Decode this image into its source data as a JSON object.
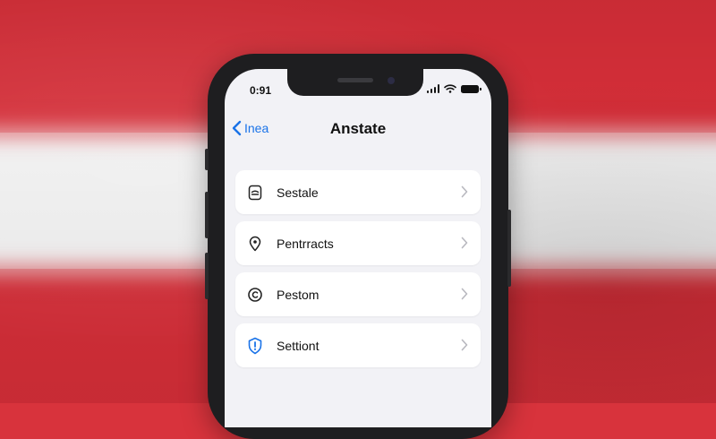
{
  "status_bar": {
    "time": "0:91"
  },
  "nav": {
    "back_label": "Inea",
    "title": "Anstate"
  },
  "settings": [
    {
      "label": "Sestale",
      "icon": "card-icon"
    },
    {
      "label": "Pentrracts",
      "icon": "location-pin-icon"
    },
    {
      "label": "Pestom",
      "icon": "privacy-icon"
    },
    {
      "label": "Settiont",
      "icon": "shield-icon"
    }
  ],
  "colors": {
    "accent": "#1a73e8",
    "flag_red": "#d42e38",
    "flag_white": "#f1f1f1",
    "screen_bg": "#f2f2f6"
  }
}
